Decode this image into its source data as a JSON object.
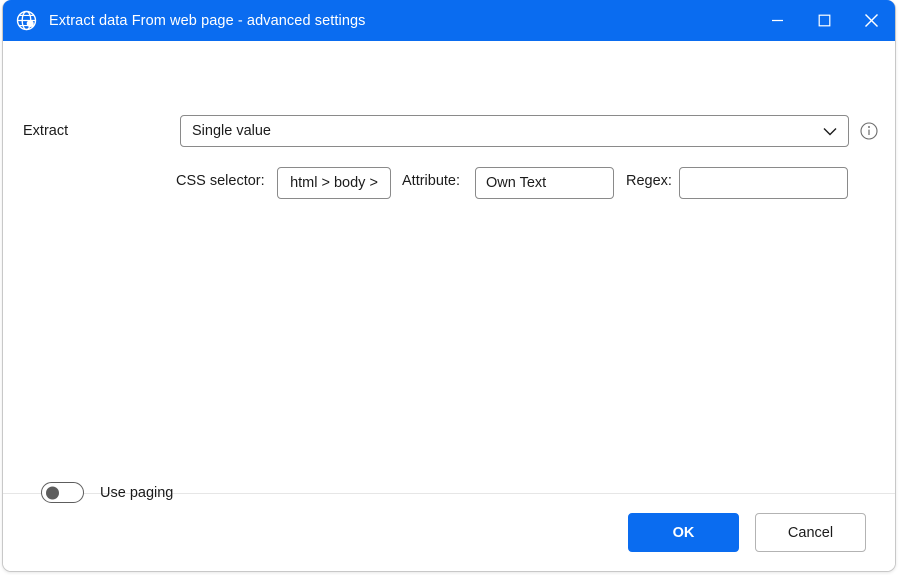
{
  "window": {
    "title": "Extract data From web page - advanced settings",
    "icon": "globe-icon",
    "accent_color": "#0a6cf0",
    "controls": {
      "minimize": "minimize-icon",
      "maximize": "maximize-icon",
      "close": "close-icon"
    }
  },
  "form": {
    "extract": {
      "label": "Extract",
      "value": "Single value",
      "options": [
        "Single value"
      ],
      "info_icon": "info-icon",
      "chevron_icon": "chevron-down-icon"
    },
    "css_selector": {
      "label": "CSS selector:",
      "value": "html > body >",
      "placeholder": ""
    },
    "attribute": {
      "label": "Attribute:",
      "value": "Own Text",
      "placeholder": ""
    },
    "regex": {
      "label": "Regex:",
      "value": "",
      "placeholder": ""
    },
    "use_paging": {
      "label": "Use paging",
      "state": "off"
    }
  },
  "footer": {
    "ok_label": "OK",
    "cancel_label": "Cancel"
  }
}
